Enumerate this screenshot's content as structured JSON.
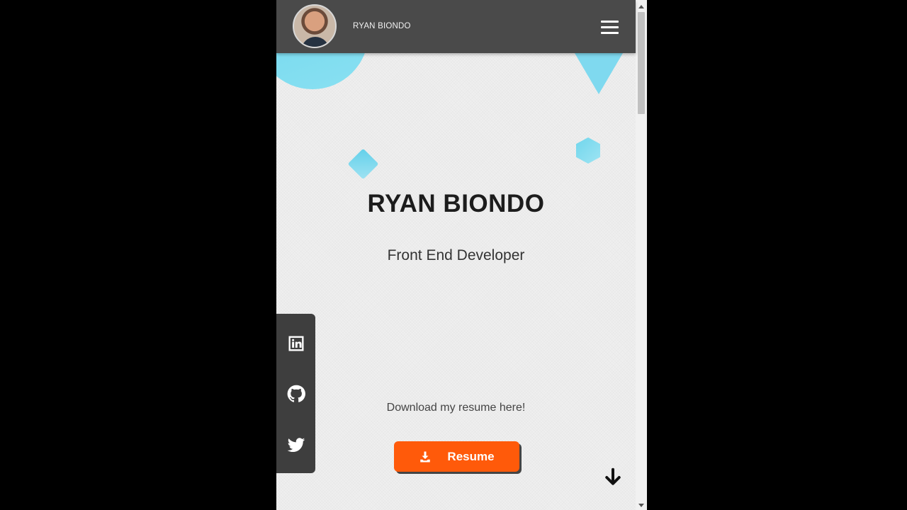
{
  "header": {
    "brand": "RYAN BIONDO",
    "menu_icon": "hamburger-icon"
  },
  "hero": {
    "name": "RYAN BIONDO",
    "title": "Front End Developer"
  },
  "resume": {
    "prompt": "Download my resume here!",
    "button_label": "Resume",
    "button_icon": "download-icon",
    "button_color": "#ff5a0a"
  },
  "social": {
    "icons": [
      "linkedin-icon",
      "github-icon",
      "twitter-icon"
    ]
  },
  "scroll_hint_icon": "arrow-down-icon",
  "colors": {
    "header_bg": "#4a4a4a",
    "accent_shapes": "#7fd9ef",
    "social_bar_bg": "#3e3e3e"
  }
}
